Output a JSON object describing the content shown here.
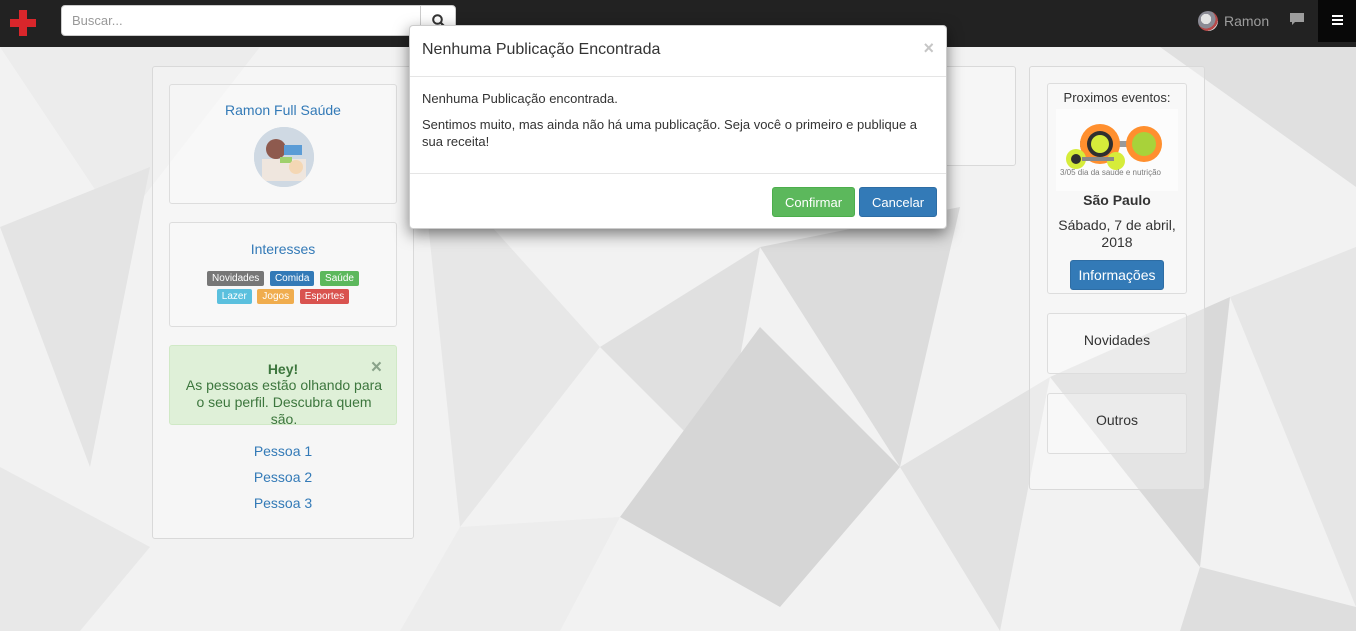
{
  "navbar": {
    "search_placeholder": "Buscar...",
    "user_name": "Ramon"
  },
  "profile": {
    "name": "Ramon Full Saúde"
  },
  "interests": {
    "title": "Interesses",
    "tags": [
      {
        "label": "Novidades",
        "color": "#777777"
      },
      {
        "label": "Comida",
        "color": "#337ab7"
      },
      {
        "label": "Saúde",
        "color": "#5cb85c"
      },
      {
        "label": "Lazer",
        "color": "#5bc0de"
      },
      {
        "label": "Jogos",
        "color": "#f0ad4e"
      },
      {
        "label": "Esportes",
        "color": "#d9534f"
      }
    ]
  },
  "alert": {
    "title": "Hey!",
    "text": "As pessoas estão olhando para o seu perfil. Descubra quem são.",
    "close": "×"
  },
  "people": [
    "Pessoa 1",
    "Pessoa 2",
    "Pessoa 3"
  ],
  "events": {
    "title": "Proximos eventos:",
    "image_caption": "3/05 dia da saude e nutrição",
    "city": "São Paulo",
    "date": "Sábado, 7 de abril, 2018",
    "button": "Informações"
  },
  "sidebar": {
    "novidades": "Novidades",
    "outros": "Outros"
  },
  "modal": {
    "title": "Nenhuma Publicação Encontrada",
    "close": "×",
    "line1": "Nenhuma Publicação encontrada.",
    "line2": "Sentimos muito, mas ainda não há uma publicação. Seja você o primeiro e publique a sua receita!",
    "confirm": "Confirmar",
    "cancel": "Cancelar"
  }
}
